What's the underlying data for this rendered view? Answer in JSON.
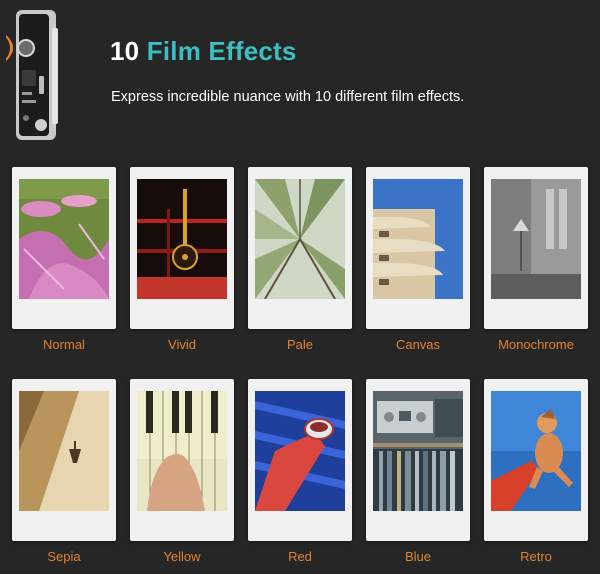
{
  "header": {
    "title_number": "10",
    "title_accent": "Film Effects",
    "subtitle": "Express incredible nuance with 10 different film effects."
  },
  "colors": {
    "background": "#262626",
    "accent_teal": "#3bbfc2",
    "caption_orange": "#e2832f",
    "frame": "#f1f1f1"
  },
  "camera": {
    "icon": "instant-camera-icon"
  },
  "effects": [
    {
      "label": "Normal"
    },
    {
      "label": "Vivid"
    },
    {
      "label": "Pale"
    },
    {
      "label": "Canvas"
    },
    {
      "label": "Monochrome"
    },
    {
      "label": "Sepia"
    },
    {
      "label": "Yellow"
    },
    {
      "label": "Red"
    },
    {
      "label": "Blue"
    },
    {
      "label": "Retro"
    }
  ]
}
